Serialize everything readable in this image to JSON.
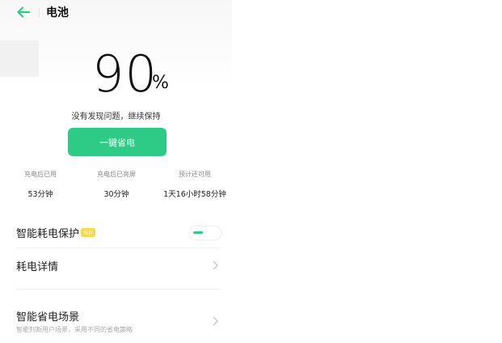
{
  "header": {
    "title": "电池"
  },
  "battery": {
    "percent": "90",
    "unit": "%"
  },
  "status_text": "没有发现问题，继续保持",
  "save_button_label": "一键省电",
  "stats": [
    {
      "label": "充电后已用",
      "value": "53分钟"
    },
    {
      "label": "充电后已亮屏",
      "value": "30分钟"
    },
    {
      "label": "预计还可用",
      "value": "1天16小时58分钟"
    }
  ],
  "settings": {
    "smart_protection": {
      "label": "智能耗电保护",
      "tag": "推荐",
      "enabled": true
    },
    "consumption_details": {
      "label": "耗电详情"
    },
    "smart_scene": {
      "label": "智能省电场景",
      "subtitle": "智能判断用户场景，采用不同的省电策略"
    }
  },
  "colors": {
    "accent": "#2ecb86",
    "tag": "#ffd447"
  },
  "icons": {
    "back": "back-arrow-icon",
    "chevron": "chevron-right-icon"
  }
}
